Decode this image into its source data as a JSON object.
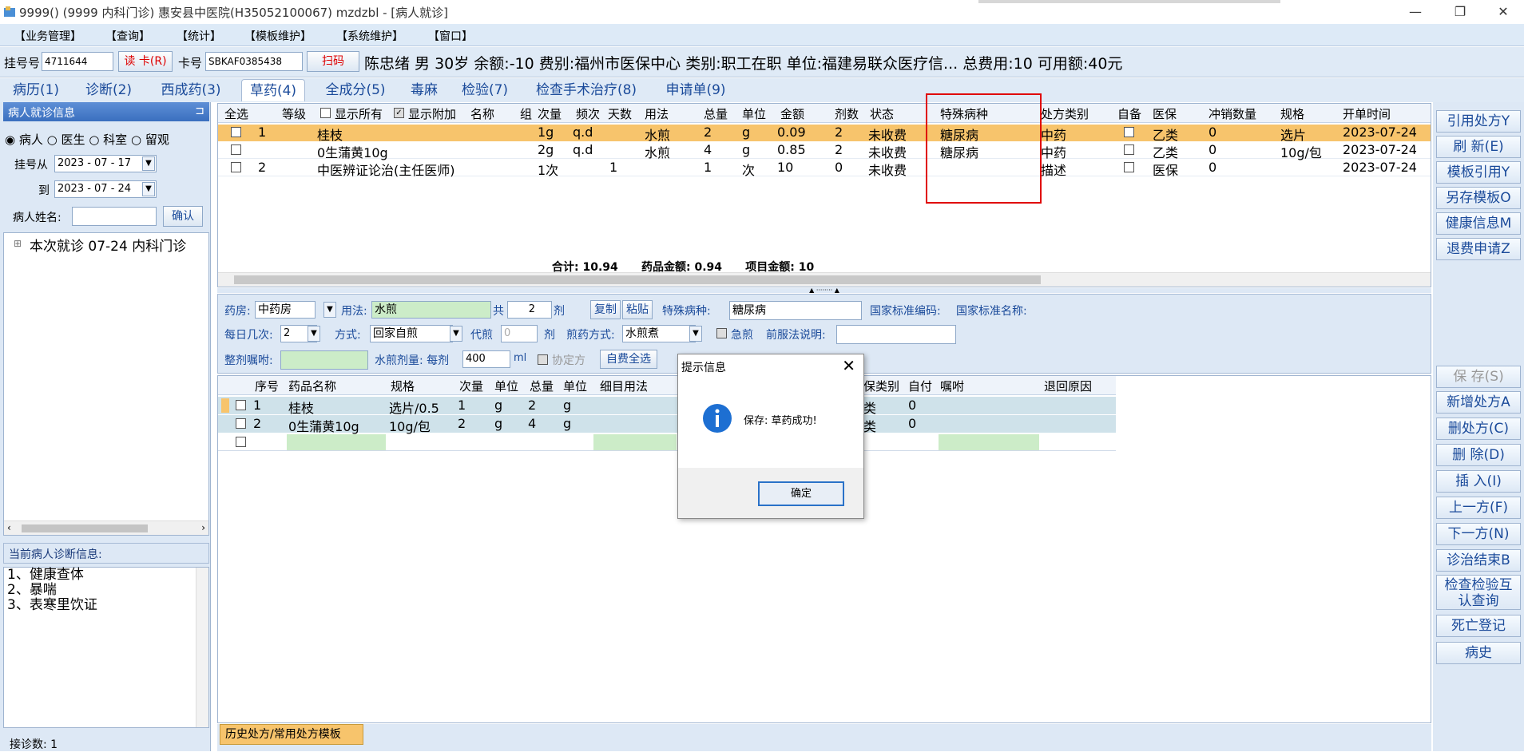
{
  "window": {
    "title": "9999() (9999 内科门诊) 惠安县中医院(H35052100067) mzdzbl - [病人就诊]",
    "minimize": "—",
    "restore": "❐",
    "close": "✕"
  },
  "menu": [
    "【业务管理】",
    "【查询】",
    "【统计】",
    "【模板维护】",
    "【系统维护】",
    "【窗口】"
  ],
  "patient": {
    "reg_label": "挂号号",
    "reg_no": "4711644",
    "read_card": "读 卡(R)",
    "card_label": "卡号",
    "card_no": "SBKAF0385438",
    "scan": "扫码",
    "info": "陈忠绪 男 30岁 余额:-10 费别:福州市医保中心 类别:职工在职 单位:福建易联众医疗信... 总费用:10 可用额:40元"
  },
  "tabs": [
    "病历(1)",
    "诊断(2)",
    "西成药(3)",
    "草药(4)",
    "全成分(5)",
    "毒麻",
    "检验(7)",
    "检查手术治疗(8)",
    "申请单(9)"
  ],
  "left": {
    "panel_title": "病人就诊信息",
    "pin": "⊐",
    "radios": [
      "病人",
      "医生",
      "科室",
      "留观"
    ],
    "date_from_label": "挂号从",
    "date_from": "2023 - 07 - 17",
    "date_to_label": "到",
    "date_to": "2023 - 07 - 24",
    "name_label": "病人姓名:",
    "confirm": "确认",
    "tree_item": "本次就诊 07-24 内科门诊",
    "diag_title": "当前病人诊断信息:",
    "diagnoses": [
      "1、健康查体",
      "2、暴喘",
      "3、表寒里饮证"
    ],
    "footer": "接诊数: 1"
  },
  "top_grid": {
    "headers": [
      "全选",
      "",
      "等级",
      "显示所有",
      "显示附加",
      "名称",
      "组",
      "次量",
      "频次",
      "天数",
      "用法",
      "总量",
      "单位",
      "金额",
      "剂数",
      "状态",
      "特殊病种",
      "处方类别",
      "自备",
      "医保",
      "冲销数量",
      "规格",
      "开单时间"
    ],
    "rows": [
      [
        "",
        "1",
        "",
        "桂枝",
        "",
        "1g",
        "q.d",
        "",
        "水煎",
        "2",
        "g",
        "0.09",
        "2",
        "未收费",
        "糖尿病",
        "中药",
        "",
        "乙类",
        "0",
        "选片",
        "2023-07-24"
      ],
      [
        "",
        "",
        "",
        "0生蒲黄10g",
        "",
        "2g",
        "q.d",
        "",
        "水煎",
        "4",
        "g",
        "0.85",
        "2",
        "未收费",
        "糖尿病",
        "中药",
        "",
        "乙类",
        "0",
        "10g/包",
        "2023-07-24"
      ],
      [
        "",
        "2",
        "",
        "中医辨证论治(主任医师)",
        "",
        "1次",
        "",
        "1",
        "",
        "1",
        "次",
        "10",
        "0",
        "未收费",
        "",
        "描述",
        "",
        "医保",
        "0",
        "",
        "2023-07-24"
      ]
    ],
    "totals": "合计: 10.94      药品金额: 0.94      项目金额: 10"
  },
  "form": {
    "pharmacy_label": "药房:",
    "pharmacy": "中药房",
    "usage_label": "用法:",
    "usage": "水煎",
    "total_label": "共",
    "total": "2",
    "dose_unit": "剂",
    "copy": "复制",
    "paste": "粘贴",
    "special_label": "特殊病种:",
    "special": "糖尿病",
    "std_code_label": "国家标准编码:",
    "std_name_label": "国家标准名称:",
    "daily_label": "每日几次:",
    "daily": "2",
    "method_label": "方式:",
    "method": "回家自煎",
    "decoct_label": "代煎",
    "decoct": "0",
    "decoct_unit": "剂",
    "decoct_way_label": "煎药方式:",
    "decoct_way": "水煎煮",
    "urgent": "急煎",
    "pre_label": "前服法说明:",
    "whole_label": "整剂嘱咐:",
    "amount_label": "水煎剂量: 每剂",
    "amount": "400",
    "amount_unit": "ml",
    "agreement": "协定方",
    "self_pay": "自费全选"
  },
  "bottom_grid": {
    "headers": [
      "",
      "序号",
      "药品名称",
      "规格",
      "次量",
      "单位",
      "总量",
      "单位",
      "细目用法",
      "",
      "保类别",
      "自付",
      "嘱咐",
      "退回原因"
    ],
    "rows": [
      [
        "",
        "1",
        "桂枝",
        "选片/0.5",
        "1",
        "g",
        "2",
        "g",
        "",
        "",
        "类",
        "0",
        "",
        ""
      ],
      [
        "",
        "2",
        "0生蒲黄10g",
        "10g/包",
        "2",
        "g",
        "4",
        "g",
        "",
        "",
        "类",
        "0",
        "",
        ""
      ]
    ]
  },
  "history_tab": "历史处方/常用处方模板",
  "right_buttons": [
    "引用处方Y",
    "刷 新(E)",
    "模板引用Y",
    "另存模板O",
    "健康信息M",
    "退费申请Z"
  ],
  "right_buttons2": [
    "保 存(S)",
    "新增处方A",
    "删处方(C)",
    "删 除(D)",
    "插 入(I)",
    "上一方(F)",
    "下一方(N)",
    "诊治结束B",
    "检查检验互认查询",
    "死亡登记",
    "病史"
  ],
  "dialog": {
    "title": "提示信息",
    "message": "保存: 草药成功!",
    "ok": "确定"
  },
  "colors": {
    "accent": "#3a6fbf",
    "selected_row": "#f7c46c",
    "highlight_box": "#e00000"
  }
}
